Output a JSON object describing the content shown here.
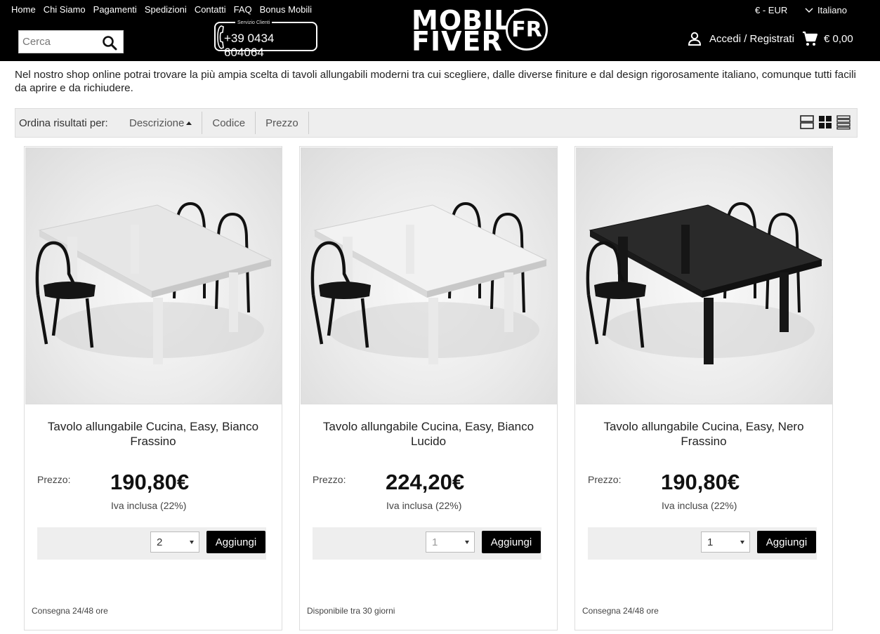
{
  "nav": {
    "links": [
      "Home",
      "Chi Siamo",
      "Pagamenti",
      "Spedizioni",
      "Contatti",
      "FAQ",
      "Bonus Mobili"
    ]
  },
  "search": {
    "placeholder": "Cerca",
    "value": ""
  },
  "phone": {
    "label": "Servizio Clienti",
    "number": "+39 0434 604064"
  },
  "logo": {
    "line1": "MOBILI",
    "line2": "FIVER",
    "badge": "FR"
  },
  "currency": "€ - EUR",
  "language": "Italiano",
  "account": {
    "login": "Accedi",
    "sep": " / ",
    "register": "Registrati"
  },
  "cart": {
    "total": "€ 0,00"
  },
  "intro": "Nel nostro shop online potrai trovare la più ampia scelta di tavoli allungabili moderni tra cui scegliere, dalle diverse finiture e dal design rigorosamente italiano, comunque tutti facili da aprire e da richiudere.",
  "sort": {
    "label": "Ordina risultati per:",
    "options": [
      "Descrizione",
      "Codice",
      "Prezzo"
    ],
    "active": "Descrizione"
  },
  "products": [
    {
      "name": "Tavolo allungabile Cucina, Easy, Bianco Frassino",
      "price_label": "Prezzo:",
      "price": "190,80€",
      "vat": "Iva inclusa (22%)",
      "qty": "2",
      "add_label": "Aggiungi",
      "delivery": "Consegna 24/48 ore",
      "table_color": "#e6e6e6"
    },
    {
      "name": "Tavolo allungabile Cucina, Easy, Bianco Lucido",
      "price_label": "Prezzo:",
      "price": "224,20€",
      "vat": "Iva inclusa (22%)",
      "qty": "1",
      "add_label": "Aggiungi",
      "delivery": "Disponibile tra 30 giorni",
      "table_color": "#f2f2f2"
    },
    {
      "name": "Tavolo allungabile Cucina, Easy, Nero Frassino",
      "price_label": "Prezzo:",
      "price": "190,80€",
      "vat": "Iva inclusa (22%)",
      "qty": "1",
      "add_label": "Aggiungi",
      "delivery": "Consegna 24/48 ore",
      "table_color": "#2a2a2a"
    }
  ]
}
